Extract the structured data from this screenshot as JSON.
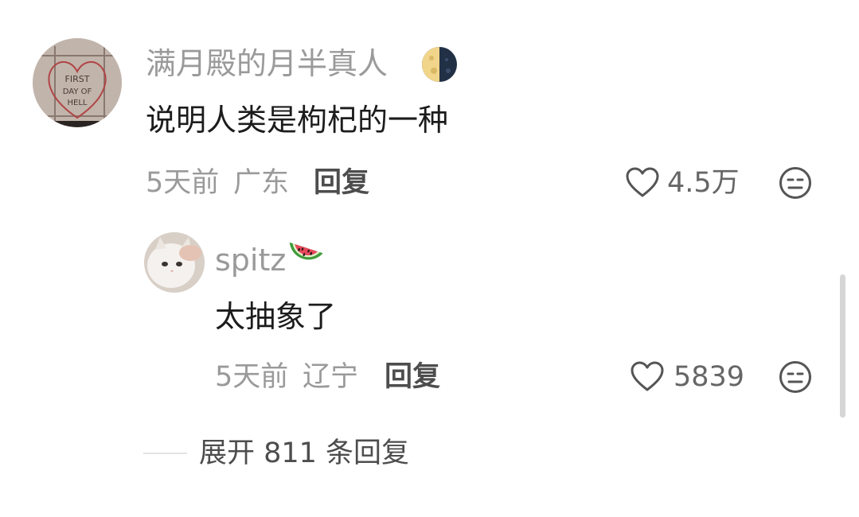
{
  "comment": {
    "username": "满月殿的月半真人",
    "badge_icon": "half-moon-icon",
    "text": "说明人类是枸杞的一种",
    "time": "5天前",
    "location": "广东",
    "reply_label": "回复",
    "like_icon": "heart-outline-icon",
    "like_count": "4.5万",
    "dislike_icon": "meh-face-icon"
  },
  "reply": {
    "username": "spitz",
    "badge_icon": "watermelon-icon",
    "text": "太抽象了",
    "time": "5天前",
    "location": "辽宁",
    "reply_label": "回复",
    "like_icon": "heart-outline-icon",
    "like_count": "5839",
    "dislike_icon": "meh-face-icon"
  },
  "expand_replies": {
    "label": "展开 811 条回复"
  },
  "avatar_main_text": [
    "FIRST",
    "DAY OF",
    "HELL"
  ],
  "colors": {
    "secondary_text": "#9a9a9a",
    "primary_text": "#1c1c1c",
    "action_text": "#4d4d4d",
    "background": "#ffffff"
  }
}
